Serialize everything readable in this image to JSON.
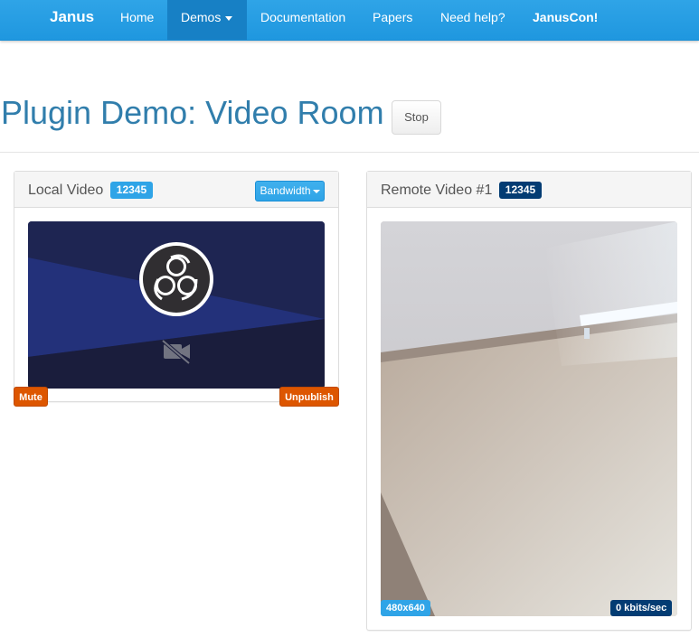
{
  "navbar": {
    "brand": "Janus",
    "items": {
      "home": "Home",
      "demos": "Demos",
      "documentation": "Documentation",
      "papers": "Papers",
      "help": "Need help?",
      "januscon": "JanusCon!"
    }
  },
  "page": {
    "title": "Plugin Demo: Video Room",
    "stop_label": "Stop"
  },
  "local": {
    "title": "Local Video",
    "badge": "12345",
    "bandwidth_label": "Bandwidth",
    "mute_label": "Mute",
    "unpublish_label": "Unpublish",
    "icons": [
      "obs-logo-icon",
      "camera-off-icon"
    ]
  },
  "remote": {
    "title": "Remote Video #1",
    "badge": "12345",
    "resolution": "480x640",
    "bitrate": "0 kbits/sec"
  },
  "colors": {
    "navbar": "#2fa4e7",
    "active_nav": "#1780c5",
    "title": "#317eac",
    "badge_info": "#2fa4e7",
    "badge_primary": "#033c73",
    "warning_button": "#dd5600"
  }
}
